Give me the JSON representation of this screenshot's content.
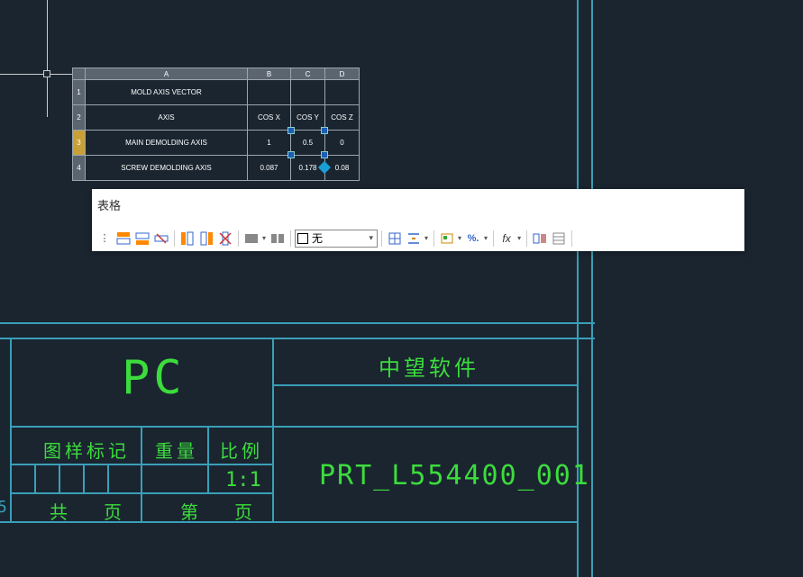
{
  "sheet": {
    "cols": [
      "A",
      "B",
      "C",
      "D"
    ],
    "rows": [
      "1",
      "2",
      "3",
      "4"
    ],
    "r1": {
      "a": "MOLD AXIS VECTOR",
      "b": "",
      "c": "",
      "d": ""
    },
    "r2": {
      "a": "AXIS",
      "b": "COS X",
      "c": "COS Y",
      "d": "COS Z"
    },
    "r3": {
      "a": "MAIN DEMOLDING AXIS",
      "b": "1",
      "c": "0.5",
      "d": "0"
    },
    "r4": {
      "a": "SCREW DEMOLDING AXIS",
      "b": "0.087",
      "c": "0.178",
      "d": "0.08"
    }
  },
  "toolbar": {
    "title": "表格",
    "fill_label": "无",
    "fx_label": "fx"
  },
  "titleblock": {
    "material": "PC",
    "company": "中望软件",
    "mark_label": "图样标记",
    "weight_label": "重量",
    "scale_label": "比例",
    "scale_value": "1:1",
    "gong": "共",
    "ye": "页",
    "di": "第",
    "ye2": "页",
    "partno": "PRT_L554400_001",
    "sheet_hint": "5"
  },
  "chart_data": {
    "type": "table",
    "title": "MOLD AXIS VECTOR",
    "columns": [
      "AXIS",
      "COS X",
      "COS Y",
      "COS Z"
    ],
    "rows": [
      {
        "AXIS": "MAIN DEMOLDING AXIS",
        "COS X": 1,
        "COS Y": 0.5,
        "COS Z": 0
      },
      {
        "AXIS": "SCREW DEMOLDING AXIS",
        "COS X": 0.087,
        "COS Y": 0.178,
        "COS Z": 0.08
      }
    ]
  }
}
